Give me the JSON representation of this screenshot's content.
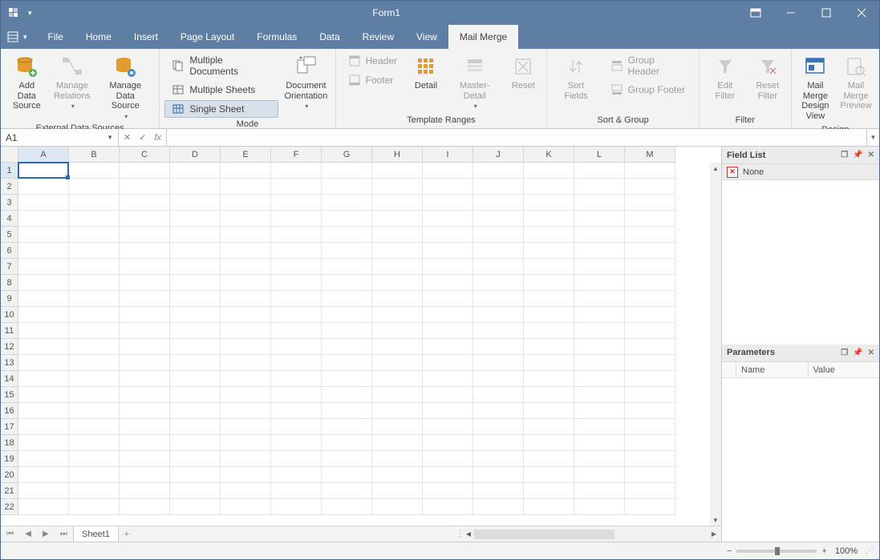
{
  "window": {
    "title": "Form1"
  },
  "menu": {
    "tabs": [
      "File",
      "Home",
      "Insert",
      "Page Layout",
      "Formulas",
      "Data",
      "Review",
      "View",
      "Mail Merge"
    ],
    "active": "Mail Merge"
  },
  "ribbon": {
    "groups": {
      "external": {
        "label": "External Data Sources",
        "add_data_source": "Add Data\nSource",
        "manage_relations": "Manage\nRelations",
        "manage_data_source": "Manage Data\nSource"
      },
      "mode": {
        "label": "Mode",
        "multiple_documents": "Multiple Documents",
        "multiple_sheets": "Multiple Sheets",
        "single_sheet": "Single Sheet",
        "document_orientation": "Document\nOrientation"
      },
      "template": {
        "label": "Template Ranges",
        "header": "Header",
        "footer": "Footer",
        "detail": "Detail",
        "master_detail": "Master-Detail",
        "reset": "Reset"
      },
      "sort": {
        "label": "Sort & Group",
        "sort_fields": "Sort Fields",
        "group_header": "Group Header",
        "group_footer": "Group Footer"
      },
      "filter": {
        "label": "Filter",
        "edit_filter": "Edit Filter",
        "reset_filter": "Reset\nFilter"
      },
      "design": {
        "label": "Design",
        "design_view": "Mail Merge\nDesign View",
        "preview": "Mail Merge\nPreview"
      }
    }
  },
  "formula_bar": {
    "name_box": "A1"
  },
  "grid": {
    "columns": [
      "A",
      "B",
      "C",
      "D",
      "E",
      "F",
      "G",
      "H",
      "I",
      "J",
      "K",
      "L",
      "M"
    ],
    "rows": [
      "1",
      "2",
      "3",
      "4",
      "5",
      "6",
      "7",
      "8",
      "9",
      "10",
      "11",
      "12",
      "13",
      "14",
      "15",
      "16",
      "17",
      "18",
      "19",
      "20",
      "21",
      "22"
    ],
    "selected_col": "A",
    "selected_row": "1"
  },
  "sheet_tabs": {
    "active": "Sheet1"
  },
  "panels": {
    "field_list": {
      "title": "Field List",
      "none_label": "None"
    },
    "parameters": {
      "title": "Parameters",
      "col_name": "Name",
      "col_value": "Value"
    }
  },
  "status": {
    "zoom": "100%"
  }
}
